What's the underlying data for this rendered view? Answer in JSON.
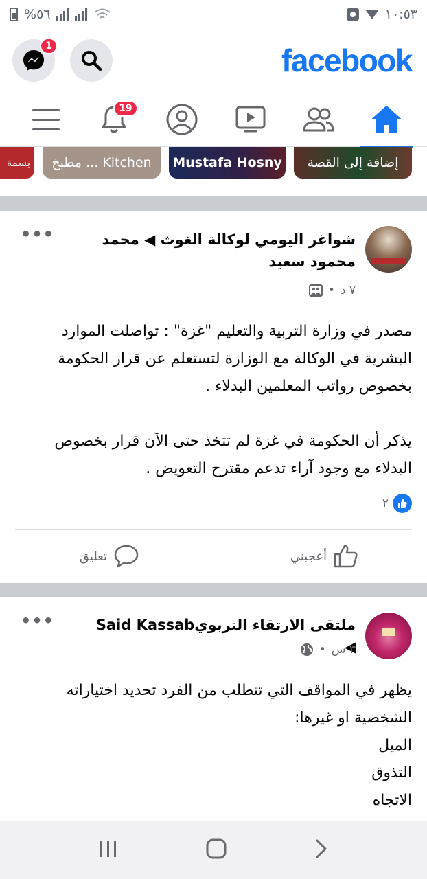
{
  "status_bar": {
    "battery": "%٥٦",
    "time": "١٠:٥٣"
  },
  "header": {
    "logo": "facebook",
    "messenger_badge": "1"
  },
  "tabs": {
    "notifications_badge": "19"
  },
  "stories": [
    {
      "label": "إضافة إلى القصة"
    },
    {
      "label": "Mustafa Hosny"
    },
    {
      "label": "مطبخ ... Kitchen"
    },
    {
      "label": "بسمة"
    }
  ],
  "posts": [
    {
      "title": "شواغر اليومي لوكالة الغوث ◀ محمد محمود سعيد",
      "time": "٧ د",
      "paragraphs": [
        "مصدر في وزارة التربية والتعليم \"غزة\" : تواصلت الموارد البشرية في الوكالة مع الوزارة لتستعلم عن قرار الحكومة بخصوص رواتب المعلمين البدلاء .",
        "يذكر أن الحكومة في غزة لم تتخذ حتى الآن قرار بخصوص البدلاء مع وجود آراء تدعم مقترح التعويض ."
      ],
      "reactions_count": "٢",
      "like_label": "أعجبني",
      "comment_label": "تعليق"
    },
    {
      "title": "ملتقى الارتقاء التربويSaid Kassab ◀",
      "time": "٣ س",
      "paragraphs": [
        "يظهر في المواقف التي تتطلب من الفرد تحديد اختياراته الشخصية او غيرها:",
        "الميل",
        "التذوق",
        "الاتجاه"
      ]
    }
  ]
}
